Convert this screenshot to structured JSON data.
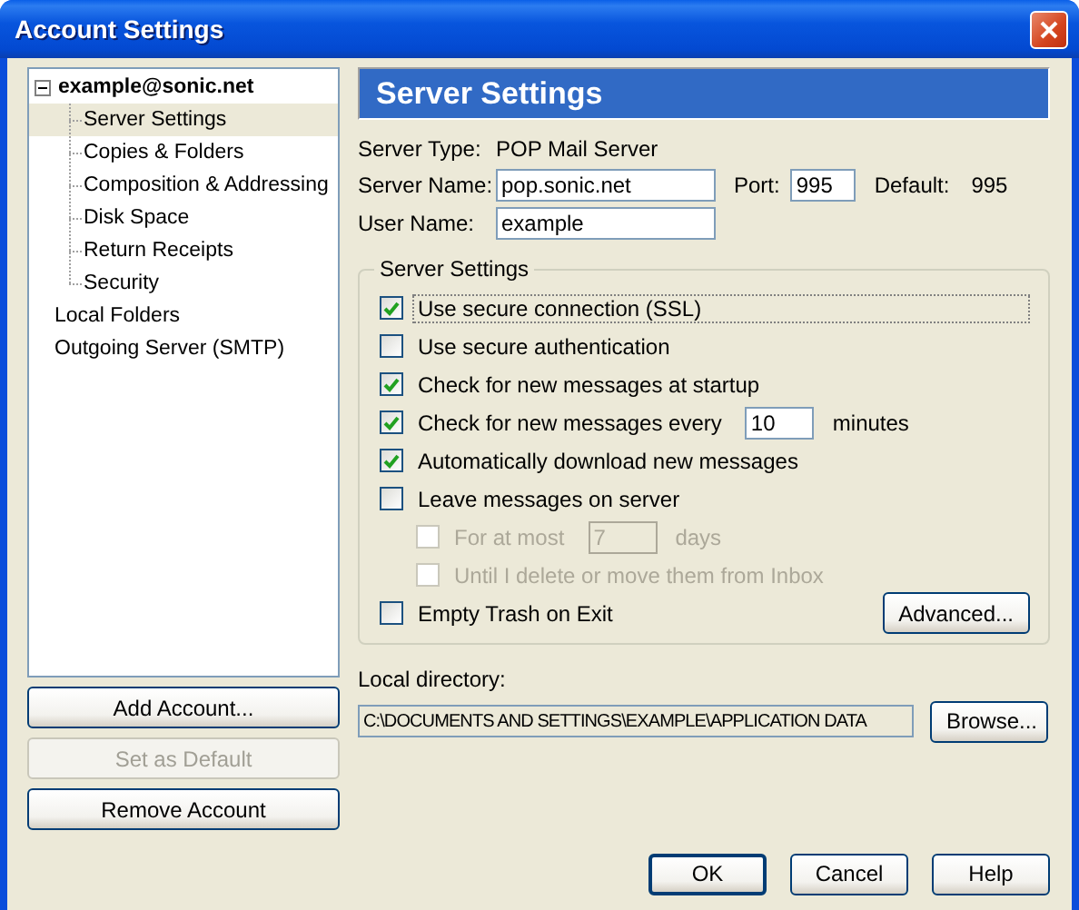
{
  "window": {
    "title": "Account Settings"
  },
  "tree": [
    {
      "label": "example@sonic.net",
      "kind": "account",
      "expanded": true,
      "selected": false,
      "children": [
        {
          "label": "Server Settings",
          "selected": true
        },
        {
          "label": "Copies & Folders",
          "selected": false
        },
        {
          "label": "Composition & Addressing",
          "selected": false
        },
        {
          "label": "Disk Space",
          "selected": false
        },
        {
          "label": "Return Receipts",
          "selected": false
        },
        {
          "label": "Security",
          "selected": false
        }
      ]
    },
    {
      "label": "Local Folders",
      "kind": "plain",
      "selected": false
    },
    {
      "label": "Outgoing Server (SMTP)",
      "kind": "plain",
      "selected": false
    }
  ],
  "account_buttons": [
    {
      "label": "Add Account...",
      "disabled": false
    },
    {
      "label": "Set as Default",
      "disabled": true
    },
    {
      "label": "Remove Account",
      "disabled": false
    }
  ],
  "panel": {
    "header": "Server Settings",
    "server_type": {
      "label": "Server Type:",
      "value": "POP Mail Server"
    },
    "server_name": {
      "label": "Server Name:",
      "value": "pop.sonic.net"
    },
    "port": {
      "label": "Port:",
      "value": "995"
    },
    "default_port": {
      "label": "Default:",
      "value": "995"
    },
    "user_name": {
      "label": "User Name:",
      "value": "example"
    },
    "group": {
      "title": "Server Settings",
      "advanced_button": "Advanced...",
      "options": [
        {
          "label": "Use secure connection (SSL)",
          "checked": true,
          "disabled": false,
          "focused": true
        },
        {
          "label": "Use secure authentication",
          "checked": false,
          "disabled": false,
          "focused": false
        },
        {
          "label": "Check for new messages at startup",
          "checked": true,
          "disabled": false,
          "focused": false
        },
        {
          "label": "Check for new messages every",
          "checked": true,
          "disabled": false,
          "focused": false,
          "input": "10",
          "suffix": "minutes"
        },
        {
          "label": "Automatically download new messages",
          "checked": true,
          "disabled": false,
          "focused": false
        },
        {
          "label": "Leave messages on server",
          "checked": false,
          "disabled": false,
          "focused": false,
          "children": [
            {
              "label": "For at most",
              "checked": false,
              "disabled": true,
              "focused": false,
              "input": "7",
              "suffix": "days"
            },
            {
              "label": "Until I delete or move them from Inbox",
              "checked": false,
              "disabled": true,
              "focused": false
            }
          ]
        },
        {
          "label": "Empty Trash on Exit",
          "checked": false,
          "disabled": false,
          "focused": false
        }
      ]
    },
    "local_directory": {
      "label": "Local directory:",
      "value": "C:\\DOCUMENTS AND SETTINGS\\EXAMPLE\\APPLICATION DATA",
      "button": "Browse..."
    }
  },
  "dialog_buttons": [
    {
      "label": "OK",
      "default": true
    },
    {
      "label": "Cancel",
      "default": false
    },
    {
      "label": "Help",
      "default": false
    }
  ]
}
